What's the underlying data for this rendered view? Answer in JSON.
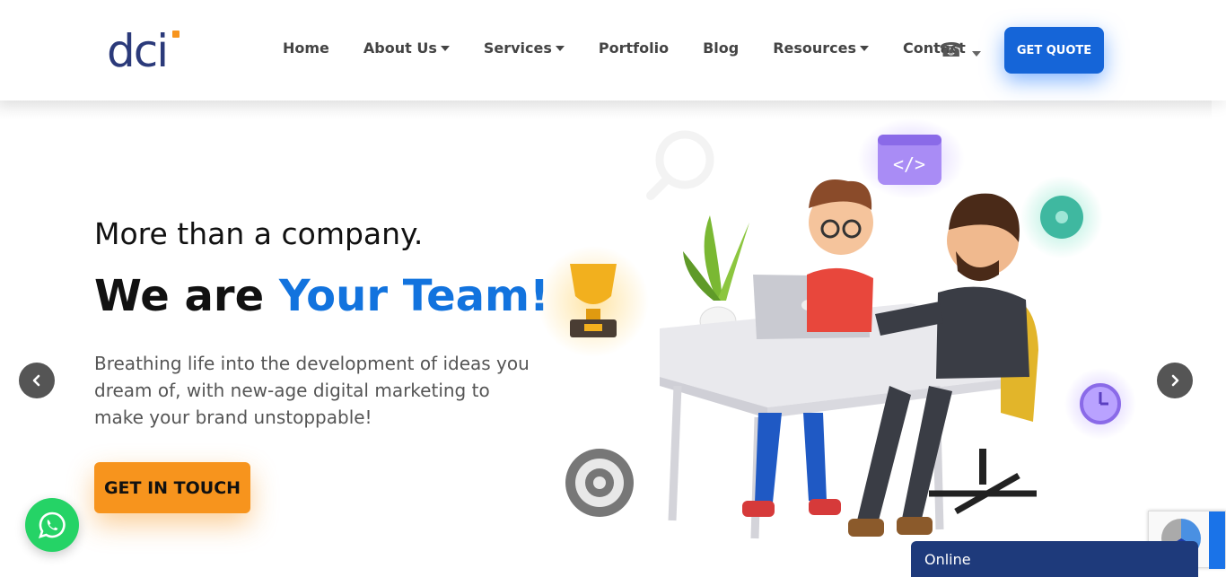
{
  "header": {
    "logo_text": "dci",
    "nav": [
      {
        "label": "Home",
        "dropdown": false
      },
      {
        "label": "About Us",
        "dropdown": true
      },
      {
        "label": "Services",
        "dropdown": true
      },
      {
        "label": "Portfolio",
        "dropdown": false
      },
      {
        "label": "Blog",
        "dropdown": false
      },
      {
        "label": "Resources",
        "dropdown": true
      },
      {
        "label": "Contact",
        "dropdown": false
      }
    ],
    "phone_icon": "☎",
    "quote_label": "GET QUOTE"
  },
  "hero": {
    "tagline": "More than a company.",
    "headline_prefix": "We are ",
    "headline_accent": "Your Team!",
    "description": "Breathing life into the development of ideas you dream of, with new-age digital marketing to make your brand unstoppable!",
    "cta_label": "GET IN TOUCH"
  },
  "chat": {
    "status": "Online"
  },
  "colors": {
    "brand_blue": "#1565d8",
    "accent_blue": "#1273de",
    "cta_orange": "#f7941d",
    "logo_navy": "#2b3a7a",
    "chat_bar": "#1e3a7b",
    "whatsapp": "#25d366"
  },
  "icons": {
    "phone": "phone-icon",
    "prev": "chevron-left-icon",
    "next": "chevron-right-icon",
    "whatsapp": "whatsapp-icon"
  }
}
